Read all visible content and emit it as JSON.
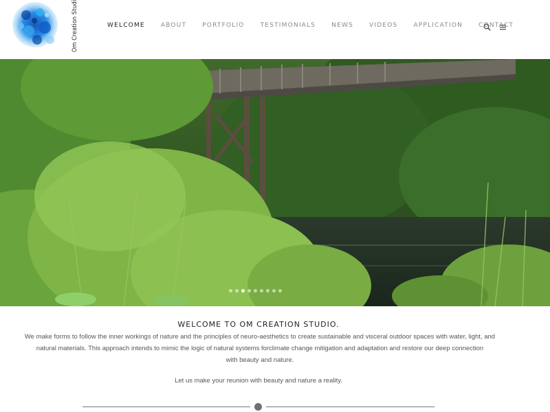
{
  "logo": {
    "text": "Om Creation Studio, LLC",
    "colors": [
      "#1e7fe0",
      "#2aa6f0",
      "#0b55b8",
      "#7cc9f5"
    ]
  },
  "nav": {
    "items": [
      {
        "label": "WELCOME",
        "active": true
      },
      {
        "label": "ABOUT",
        "active": false
      },
      {
        "label": "PORTFOLIO",
        "active": false
      },
      {
        "label": "TESTIMONIALS",
        "active": false
      },
      {
        "label": "NEWS",
        "active": false
      },
      {
        "label": "VIDEOS",
        "active": false
      },
      {
        "label": "APPLICATION",
        "active": false
      },
      {
        "label": "CONTACT",
        "active": false
      }
    ],
    "search_icon": "search-icon",
    "menu_icon": "hamburger-menu-icon"
  },
  "hero": {
    "slide_count": 9,
    "active_slide": 3
  },
  "content": {
    "title": "WELCOME TO OM CREATION STUDIO.",
    "paragraph_line1": "We make forms to follow the inner workings of nature and the principles of neuro-aesthetics to create sustainable and visceral outdoor spaces with water, light, and",
    "paragraph_line2": "natural materials.  This approach intends to mimic the logic of  natural systems forclimate change mitigation and adaptation and restore our deep connection",
    "paragraph_line3": "with beauty and nature.",
    "cta": "Let us make your reunion with beauty and nature a reality."
  },
  "colors": {
    "accent": "#222222",
    "nav_inactive": "#8a8a8a",
    "divider": "#707070"
  }
}
